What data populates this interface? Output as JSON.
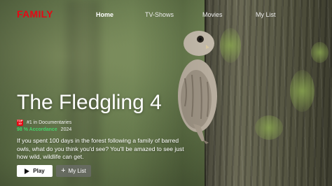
{
  "brand": {
    "logo": "FAMILY",
    "color": "#e50914"
  },
  "nav": {
    "items": [
      {
        "label": "Home",
        "active": true
      },
      {
        "label": "TV-Shows",
        "active": false
      },
      {
        "label": "Movies",
        "active": false
      },
      {
        "label": "My List",
        "active": false
      }
    ]
  },
  "hero": {
    "title": "The Fledgling 4",
    "badge": {
      "icon": "top-10-icon",
      "line1": "TOP",
      "line2": "10"
    },
    "rank_text": "#1 in Documentaries",
    "match_text": "98 % Accordance",
    "year": "2024",
    "description": "If you spent 100 days in the forest following a family of barred owls, what do you think you'd see? You'll be amazed to see just how wild, wildlife can get."
  },
  "actions": {
    "play_label": "Play",
    "list_label": "My List"
  },
  "colors": {
    "accent": "#e50914",
    "match": "#46d369"
  }
}
